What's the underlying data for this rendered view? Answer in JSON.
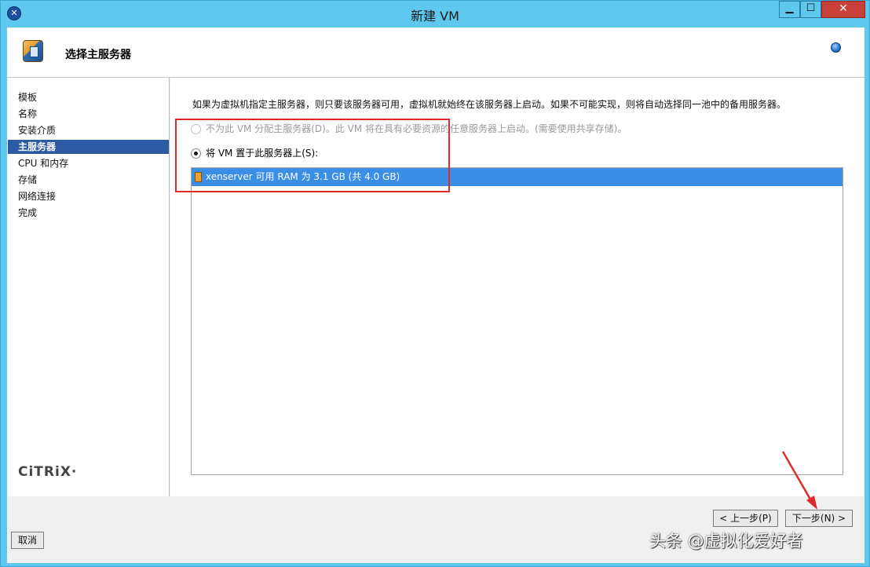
{
  "window": {
    "title": "新建 VM",
    "app_icon": "x-icon",
    "controls": [
      "minimize-icon",
      "maximize-icon",
      "close-icon"
    ]
  },
  "header": {
    "title": "选择主服务器",
    "icon": "server-icon",
    "help_icon": "help-icon"
  },
  "sidebar": {
    "items": [
      {
        "label": "模板"
      },
      {
        "label": "名称"
      },
      {
        "label": "安装介质"
      },
      {
        "label": "主服务器"
      },
      {
        "label": "CPU 和内存"
      },
      {
        "label": "存储"
      },
      {
        "label": "网络连接"
      },
      {
        "label": "完成"
      }
    ],
    "active_index": 3,
    "logo": "CiTRiX·"
  },
  "main": {
    "description": "如果为虚拟机指定主服务器，则只要该服务器可用，虚拟机就始终在该服务器上启动。如果不可能实现，则将自动选择同一池中的备用服务器。",
    "options": [
      {
        "label": "不为此 VM 分配主服务器(D)。此 VM 将在具有必要资源的任意服务器上启动。(需要使用共享存储)。",
        "enabled": false,
        "selected": false
      },
      {
        "label": "将 VM 置于此服务器上(S):",
        "enabled": true,
        "selected": true
      }
    ],
    "servers": [
      {
        "label": "xenserver   可用 RAM 为 3.1 GB (共 4.0 GB)",
        "selected": true
      }
    ]
  },
  "footer": {
    "cancel_label": "取消",
    "prev_label": "< 上一步(P)",
    "next_label": "下一步(N) >"
  },
  "annotations": {
    "highlight_color": "#e02b2b"
  },
  "watermark": "头条 @虚拟化爱好者",
  "colors": {
    "titlebar": "#5fc8ef",
    "selection": "#3a8ee6",
    "sidebar_active": "#2c5ba4"
  }
}
